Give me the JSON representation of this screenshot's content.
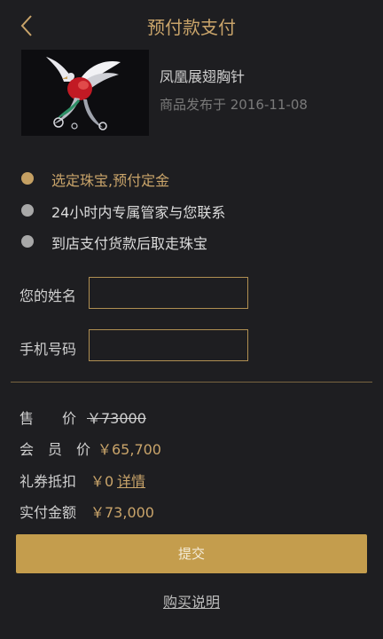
{
  "header": {
    "title": "预付款支付",
    "back_icon": "chevron-left-icon"
  },
  "product": {
    "name": "凤凰展翅胸针",
    "release": "商品发布于 2016-11-08",
    "image": "phoenix-brooch-image"
  },
  "steps": [
    {
      "label": "选定珠宝,预付定金",
      "active": true
    },
    {
      "label": "24小时内专属管家与您联系",
      "active": false
    },
    {
      "label": "到店支付货款后取走珠宝",
      "active": false
    }
  ],
  "form": {
    "name_label": "您的姓名",
    "name_value": "",
    "phone_label": "手机号码",
    "phone_value": ""
  },
  "pricing": {
    "price_label": "售　　价",
    "price_value": "￥73000",
    "member_label": "会　员　价",
    "member_value": "￥65,700",
    "coupon_label": "礼券抵扣",
    "coupon_value": "￥0",
    "coupon_link": "详情",
    "paid_label": "实付金额",
    "paid_value": "￥73,000"
  },
  "submit_label": "提交",
  "help_link": "购买说明",
  "colors": {
    "background": "#1e1e21",
    "accent": "#c9a46a",
    "button": "#c49d4d",
    "inactive_dot": "#a8a8a8"
  }
}
